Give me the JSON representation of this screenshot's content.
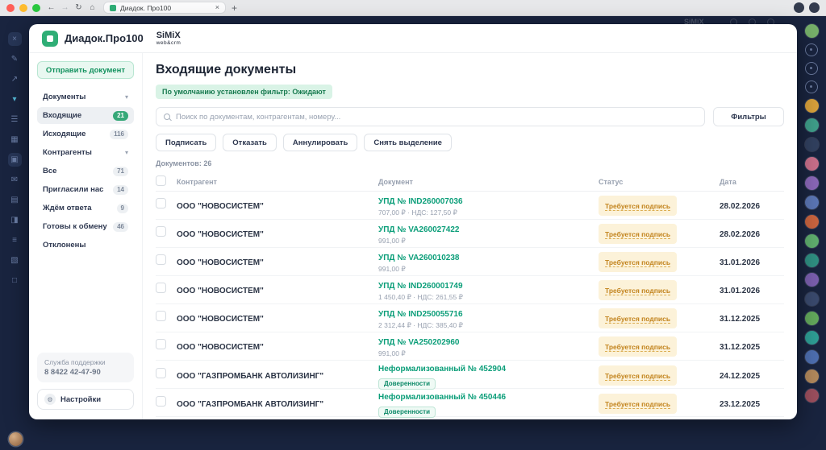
{
  "browser": {
    "tab_title": "Диадок. Про100",
    "traffic_lights": [
      "#ff5f57",
      "#febc2e",
      "#2ac840"
    ],
    "nav_icons": [
      {
        "name": "back-icon",
        "glyph": "←",
        "dim": false
      },
      {
        "name": "forward-icon",
        "glyph": "→",
        "dim": true
      },
      {
        "name": "reload-icon",
        "glyph": "↻",
        "dim": false
      },
      {
        "name": "home-icon",
        "glyph": "⌂",
        "dim": false
      }
    ],
    "new_tab_glyph": "+"
  },
  "background": {
    "ghost_text": "SiMiX"
  },
  "left_toolbar": [
    {
      "name": "close-icon",
      "glyph": "×",
      "boxed": true
    },
    {
      "name": "edit-icon",
      "glyph": "✎",
      "boxed": false
    },
    {
      "name": "share-icon",
      "glyph": "↗",
      "boxed": false
    },
    {
      "name": "filter-icon",
      "glyph": "▾",
      "boxed": false,
      "color": "#55b9d6"
    },
    {
      "name": "menu-icon",
      "glyph": "☰",
      "boxed": false
    },
    {
      "name": "grid-icon",
      "glyph": "▦",
      "boxed": false
    },
    {
      "name": "panel-icon",
      "glyph": "▣",
      "boxed": true
    },
    {
      "name": "mail-icon",
      "glyph": "✉",
      "boxed": false
    },
    {
      "name": "document-icon",
      "glyph": "▤",
      "boxed": false
    },
    {
      "name": "split-icon",
      "glyph": "◨",
      "boxed": false
    },
    {
      "name": "list-icon",
      "glyph": "≡",
      "boxed": false
    },
    {
      "name": "pattern-icon",
      "glyph": "▧",
      "boxed": false
    },
    {
      "name": "square-icon",
      "glyph": "□",
      "boxed": false
    }
  ],
  "right_dock": [
    {
      "name": "profile-avatar",
      "type": "avatar",
      "color": "#76b06a"
    },
    {
      "name": "notifications-icon",
      "type": "icon"
    },
    {
      "name": "bookmarks-icon",
      "type": "icon"
    },
    {
      "name": "history-icon",
      "type": "icon"
    },
    {
      "name": "contact-avatar",
      "type": "avatar",
      "color": "#d9a13b"
    },
    {
      "name": "contact-avatar",
      "type": "avatar",
      "color": "#3f9e8a"
    },
    {
      "name": "contact-avatar",
      "type": "avatar",
      "color": "#31405f"
    },
    {
      "name": "contact-avatar",
      "type": "avatar",
      "color": "#c96f8a"
    },
    {
      "name": "contact-avatar",
      "type": "avatar",
      "color": "#8a67b8"
    },
    {
      "name": "contact-avatar",
      "type": "avatar",
      "color": "#5b76b5"
    },
    {
      "name": "contact-avatar",
      "type": "avatar",
      "color": "#c9643f"
    },
    {
      "name": "contact-avatar",
      "type": "avatar",
      "color": "#5fae6e"
    },
    {
      "name": "contact-avatar",
      "type": "avatar",
      "color": "#2f8f82"
    },
    {
      "name": "contact-avatar",
      "type": "avatar",
      "color": "#7a5fae"
    },
    {
      "name": "contact-avatar",
      "type": "avatar",
      "color": "#3a4a6e"
    },
    {
      "name": "contact-avatar",
      "type": "avatar",
      "color": "#63a95c"
    },
    {
      "name": "contact-avatar",
      "type": "avatar",
      "color": "#2e9e95"
    },
    {
      "name": "contact-avatar",
      "type": "avatar",
      "color": "#4e6fb0"
    },
    {
      "name": "contact-avatar",
      "type": "avatar",
      "color": "#b2895c"
    },
    {
      "name": "contact-avatar",
      "type": "avatar",
      "color": "#9c4f5e"
    }
  ],
  "app": {
    "brand": "Диадок.Про100",
    "partner_name": "SiMiX",
    "partner_sub": "web&crm"
  },
  "sidebar": {
    "send_button": "Отправить документ",
    "nav": [
      {
        "label": "Документы",
        "type": "group"
      },
      {
        "label": "Входящие",
        "count": "21",
        "active": true
      },
      {
        "label": "Исходящие",
        "count": "116"
      },
      {
        "label": "Контрагенты",
        "type": "group"
      },
      {
        "label": "Все",
        "count": "71"
      },
      {
        "label": "Пригласили нас",
        "count": "14"
      },
      {
        "label": "Ждём ответа",
        "count": "9"
      },
      {
        "label": "Готовы к обмену",
        "count": "46"
      },
      {
        "label": "Отклонены"
      }
    ],
    "support_line1": "Служба поддержки",
    "support_line2": "8 8422 42-47-90",
    "settings_label": "Настройки"
  },
  "main": {
    "title": "Входящие документы",
    "filter_notice": "По умолчанию установлен фильтр: Ожидают",
    "search_placeholder": "Поиск по документам, контрагентам, номеру...",
    "filters_button": "Фильтры",
    "actions": [
      "Подписать",
      "Отказать",
      "Аннулировать",
      "Снять выделение"
    ],
    "docs_count": "Документов: 26",
    "table": {
      "headers": {
        "counterparty": "Контрагент",
        "document": "Документ",
        "status": "Статус",
        "date": "Дата"
      },
      "rows": [
        {
          "counterparty": "ООО \"НОВОСИСТЕМ\"",
          "doc": "УПД № IND260007036",
          "sub": "707,00 ₽ · НДС: 127,50 ₽",
          "status": "Требуется подпись",
          "date": "28.02.2026"
        },
        {
          "counterparty": "ООО \"НОВОСИСТЕМ\"",
          "doc": "УПД № VA260027422",
          "sub": "991,00 ₽",
          "status": "Требуется подпись",
          "date": "28.02.2026"
        },
        {
          "counterparty": "ООО \"НОВОСИСТЕМ\"",
          "doc": "УПД № VA260010238",
          "sub": "991,00 ₽",
          "status": "Требуется подпись",
          "date": "31.01.2026"
        },
        {
          "counterparty": "ООО \"НОВОСИСТЕМ\"",
          "doc": "УПД № IND260001749",
          "sub": "1 450,40 ₽ · НДС: 261,55 ₽",
          "status": "Требуется подпись",
          "date": "31.01.2026"
        },
        {
          "counterparty": "ООО \"НОВОСИСТЕМ\"",
          "doc": "УПД № IND250055716",
          "sub": "2 312,44 ₽ · НДС: 385,40 ₽",
          "status": "Требуется подпись",
          "date": "31.12.2025"
        },
        {
          "counterparty": "ООО \"НОВОСИСТЕМ\"",
          "doc": "УПД № VA250202960",
          "sub": "991,00 ₽",
          "status": "Требуется подпись",
          "date": "31.12.2025"
        },
        {
          "counterparty": "ООО \"ГАЗПРОМБАНК АВТОЛИЗИНГ\"",
          "doc": "Неформализованный № 452904",
          "badge": "Доверенности",
          "status": "Требуется подпись",
          "date": "24.12.2025"
        },
        {
          "counterparty": "ООО \"ГАЗПРОМБАНК АВТОЛИЗИНГ\"",
          "doc": "Неформализованный № 450446",
          "badge": "Доверенности",
          "status": "Требуется подпись",
          "date": "23.12.2025"
        }
      ]
    }
  },
  "colors": {
    "brand_green": "#2fae76",
    "link_teal": "#0b9e79",
    "status_amber": "#c2831c",
    "frame_navy": "#19243f"
  }
}
